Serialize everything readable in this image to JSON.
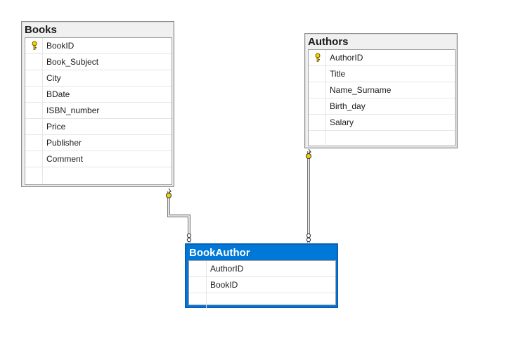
{
  "tables": {
    "books": {
      "title": "Books",
      "columns": [
        "BookID",
        "Book_Subject",
        "City",
        "BDate",
        "ISBN_number",
        "Price",
        "Publisher",
        "Comment"
      ],
      "primary_key": "BookID"
    },
    "authors": {
      "title": "Authors",
      "columns": [
        "AuthorID",
        "Title",
        "Name_Surname",
        "Birth_day",
        "Salary"
      ],
      "primary_key": "AuthorID"
    },
    "bookauthor": {
      "title": "BookAuthor",
      "columns": [
        "AuthorID",
        "BookID"
      ],
      "selected": true
    }
  },
  "icons": {
    "primary_key": "key-icon",
    "relationship_one": "key-endpoint-icon",
    "relationship_many": "infinity-endpoint-icon"
  },
  "colors": {
    "selection": "#0078d7",
    "key": "#f2d200",
    "line": "#7a7a7a"
  }
}
